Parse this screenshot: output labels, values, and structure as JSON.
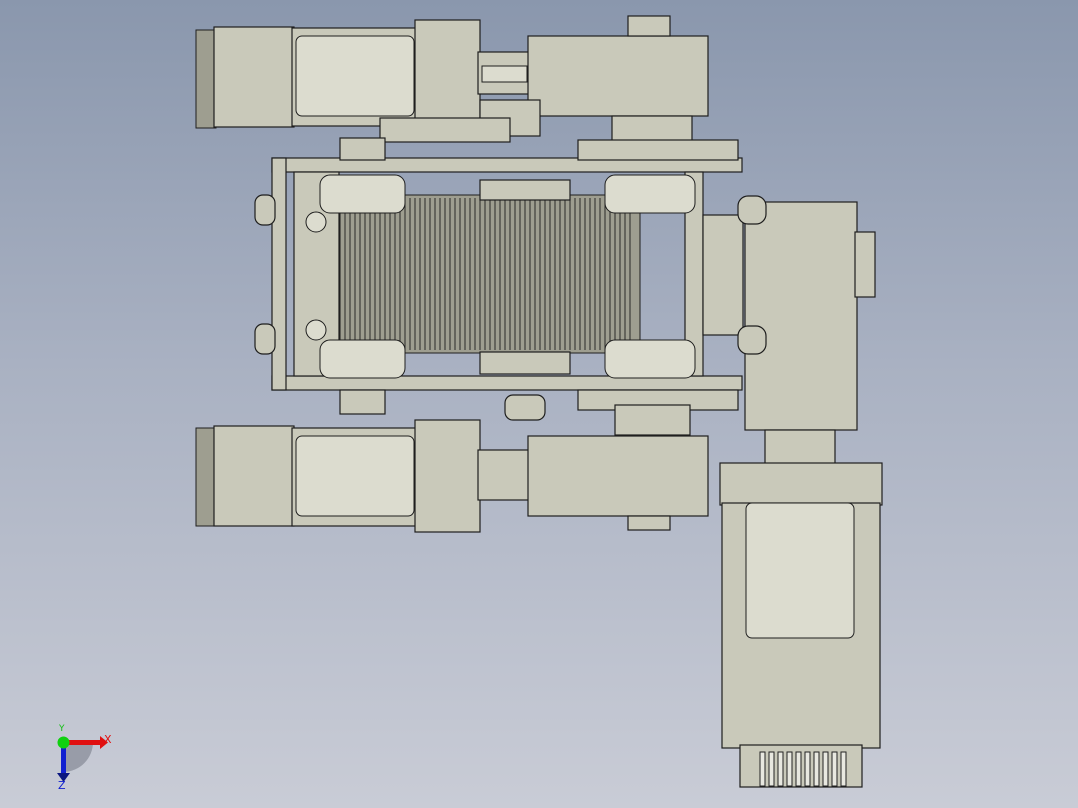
{
  "triad": {
    "x_label": "X",
    "y_label": "Y",
    "z_label": "Z",
    "colors": {
      "x": "#e01010",
      "y": "#10c010",
      "z": "#1020d0"
    }
  },
  "viewport": {
    "background_top": "#8a97ad",
    "background_bottom": "#c9ccd6"
  }
}
